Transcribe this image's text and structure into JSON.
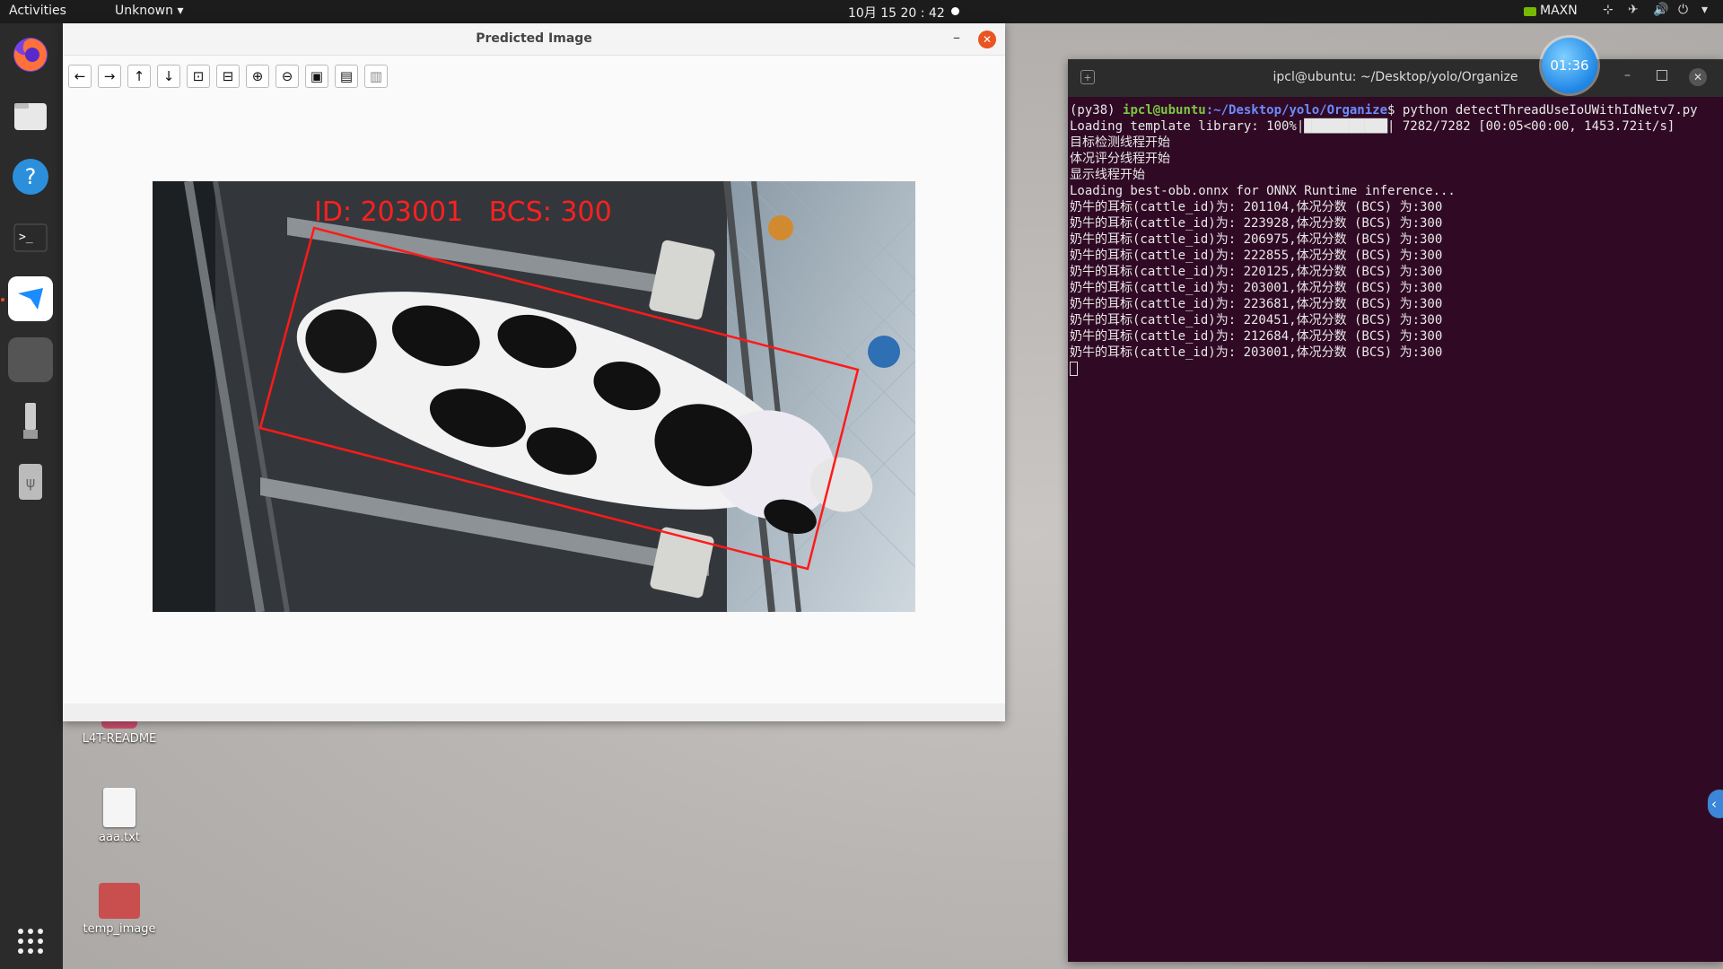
{
  "topbar": {
    "activities": "Activities",
    "app_menu": "Unknown ▾",
    "clock": "10月 15 20 : 42",
    "power_mode": "MAXN"
  },
  "dock": {
    "items": [
      "firefox-icon",
      "files-icon",
      "help-icon",
      "terminal-icon",
      "teamviewer-icon",
      "usb-drive-icon",
      "usb-icon",
      "app-grid-icon"
    ]
  },
  "desktop": {
    "icons": [
      {
        "label": "L4T-README"
      },
      {
        "label": "aaa.txt"
      },
      {
        "label": "temp_image"
      }
    ]
  },
  "image_window": {
    "title": "Predicted Image",
    "toolbar": [
      "←",
      "→",
      "↑",
      "↓",
      "⊡",
      "⊟",
      "⊕",
      "⊖",
      "▣",
      "▤",
      "▥"
    ],
    "overlay_label": "ID: 203001   BCS: 300"
  },
  "terminal": {
    "title": "ipcl@ubuntu: ~/Desktop/yolo/Organize",
    "prompt_env": "(py38) ",
    "prompt_user": "ipcl@ubuntu",
    "prompt_path": ":~/Desktop/yolo/Organize",
    "command": "$ python detectThreadUseIoUWithIdNetv7.py",
    "lines": [
      "Loading template library: 100%|███████████| 7282/7282 [00:05<00:00, 1453.72it/s]",
      "目标检测线程开始",
      "体况评分线程开始",
      "显示线程开始",
      "Loading best-obb.onnx for ONNX Runtime inference...",
      "奶牛的耳标(cattle_id)为: 201104,体况分数 (BCS) 为:300",
      "奶牛的耳标(cattle_id)为: 223928,体况分数 (BCS) 为:300",
      "奶牛的耳标(cattle_id)为: 206975,体况分数 (BCS) 为:300",
      "奶牛的耳标(cattle_id)为: 222855,体况分数 (BCS) 为:300",
      "奶牛的耳标(cattle_id)为: 220125,体况分数 (BCS) 为:300",
      "奶牛的耳标(cattle_id)为: 203001,体况分数 (BCS) 为:300",
      "奶牛的耳标(cattle_id)为: 223681,体况分数 (BCS) 为:300",
      "奶牛的耳标(cattle_id)为: 220451,体况分数 (BCS) 为:300",
      "奶牛的耳标(cattle_id)为: 212684,体况分数 (BCS) 为:300",
      "奶牛的耳标(cattle_id)为: 203001,体况分数 (BCS) 为:300"
    ]
  },
  "timer": "01:36"
}
